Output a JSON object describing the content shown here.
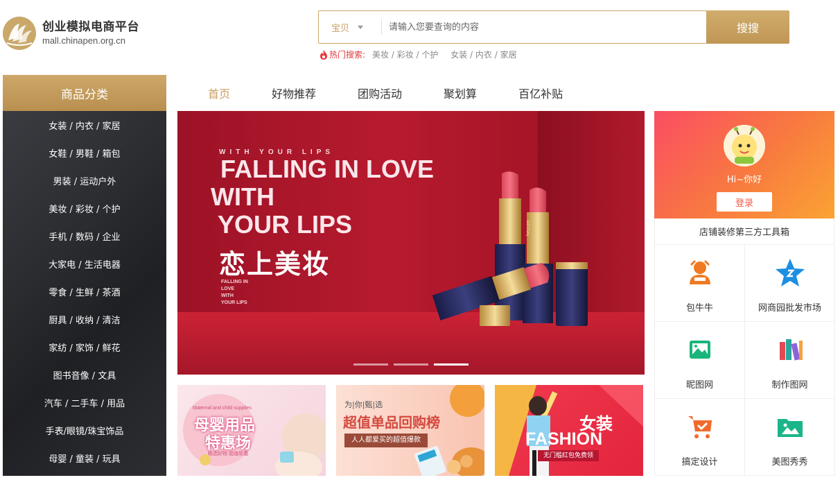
{
  "site": {
    "title": "创业模拟电商平台",
    "domain": "mall.chinapen.org.cn"
  },
  "search": {
    "scope": "宝贝",
    "placeholder": "请输入您要查询的内容",
    "button": "搜搜"
  },
  "hot": {
    "label": "热门搜索:",
    "terms": [
      "美妆 / 彩妆 / 个护",
      "女装 / 内衣 / 家居"
    ]
  },
  "categories": {
    "title": "商品分类",
    "items": [
      "女装 / 内衣 / 家居",
      "女鞋 / 男鞋 / 箱包",
      "男装 / 运动户外",
      "美妆 / 彩妆 / 个护",
      "手机 / 数码 / 企业",
      "大家电 / 生活电器",
      "零食 / 生鲜 / 茶酒",
      "厨具 / 收纳 / 清洁",
      "家纺 / 家饰 / 鲜花",
      "图书音像 / 文具",
      "汽车 / 二手车 / 用品",
      "手表/眼镜/珠宝饰品",
      "母婴 / 童装 / 玩具"
    ]
  },
  "nav": {
    "items": [
      "首页",
      "好物推荐",
      "团购活动",
      "聚划算",
      "百亿补贴"
    ]
  },
  "banner": {
    "tagline": "WITH YOUR LIPS",
    "line1": "FALLING IN LOVE",
    "line2": "WITH",
    "line3": "YOUR LIPS",
    "cn": "恋上美妆",
    "small1": "FALLING IN",
    "small2": "LOVE",
    "small3": "WITH",
    "small4": "YOUR LIPS",
    "brand": "heccze",
    "active_slide": 3,
    "slide_count": 3
  },
  "promos": {
    "p1": {
      "title": "母婴用品",
      "sub": "特惠场",
      "en": "Maternal and child supplies",
      "note": "精选好物 超值钜惠"
    },
    "p2": {
      "top": "为|你|甄|选",
      "title": "超值单品回购榜",
      "tag": "人人都爱买的超值爆款"
    },
    "p3": {
      "title": "女装",
      "en": "FASHION",
      "tag": "无门槛红包免费领"
    }
  },
  "user": {
    "greeting": "Hi~你好",
    "login": "登录",
    "toolbox_title": "店铺装修第三方工具箱"
  },
  "tools": [
    {
      "label": "包牛牛",
      "icon": "person-tool-icon",
      "color": "#f07a22"
    },
    {
      "label": "网商园批发市场",
      "icon": "star-icon",
      "color": "#1d8fe1"
    },
    {
      "label": "昵图网",
      "icon": "image-icon",
      "color": "#19b57a"
    },
    {
      "label": "制作图网",
      "icon": "books-icon",
      "color": "#e14a55"
    },
    {
      "label": "搞定设计",
      "icon": "cart-icon",
      "color": "#f26a2b"
    },
    {
      "label": "美图秀秀",
      "icon": "folder-image-icon",
      "color": "#1cb58a"
    }
  ]
}
